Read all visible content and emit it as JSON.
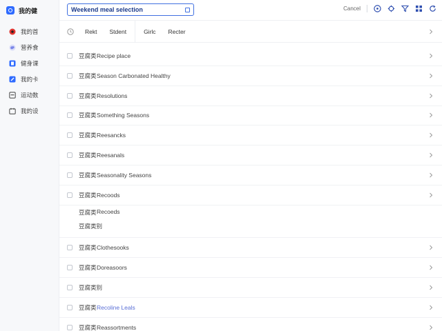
{
  "app": {
    "name": "我的健"
  },
  "sidebar": {
    "items": [
      {
        "label": "我的首",
        "icon": "record-icon",
        "color": "#e0342f"
      },
      {
        "label": "营养食",
        "icon": "cloud-icon",
        "color": "#7a86e8"
      },
      {
        "label": "健身课",
        "icon": "book-icon",
        "color": "#2f6bff"
      },
      {
        "label": "我的卡",
        "icon": "pencil-square-icon",
        "color": "#2f6bff"
      },
      {
        "label": "运动数",
        "icon": "chart-icon",
        "color": "#555555"
      },
      {
        "label": "我的设",
        "icon": "calendar-icon",
        "color": "#555555"
      }
    ]
  },
  "search": {
    "value": "Weekend meal selection"
  },
  "topbar": {
    "cancel_label": "Cancel"
  },
  "tabs": [
    {
      "label": "Rekt"
    },
    {
      "label": "Stdent"
    },
    {
      "label": "Girlc"
    },
    {
      "label": "Recter"
    }
  ],
  "rows": [
    {
      "code": "豆腐类",
      "name": "Recipe place",
      "checkbox": true
    },
    {
      "code": "豆腐类",
      "name": "Season Carbonated Healthy",
      "checkbox": true
    },
    {
      "code": "豆腐类",
      "name": "Resolutions",
      "checkbox": true
    },
    {
      "code": "豆腐类",
      "name": "Something Seasons",
      "checkbox": true
    },
    {
      "code": "豆腐类",
      "name": "Reesancks",
      "checkbox": true
    },
    {
      "code": "豆腐类",
      "name": "Reesanals",
      "checkbox": true
    },
    {
      "code": "豆腐类",
      "name": "Seasonality Seasons",
      "checkbox": true
    },
    {
      "code": "豆腐类",
      "name": "Recoods",
      "checkbox": true
    },
    {
      "code": "豆腐类",
      "name": "Recoeds",
      "checkbox": false,
      "sub": "豆腐类别"
    },
    {
      "code": "豆腐类",
      "name": "Clothesooks",
      "checkbox": true
    },
    {
      "code": "豆腐类",
      "name": "Doreasoors",
      "checkbox": true
    },
    {
      "code": "豆腐类别",
      "name": "",
      "checkbox": true
    },
    {
      "code": "豆腐类",
      "name": "Recoline Leals",
      "checkbox": true,
      "link": true
    },
    {
      "code": "豆腐类",
      "name": "Reassortments",
      "checkbox": true
    }
  ],
  "colors": {
    "accent": "#3f6fe0",
    "brand": "#2f6bff",
    "link": "#5a6fd6"
  }
}
